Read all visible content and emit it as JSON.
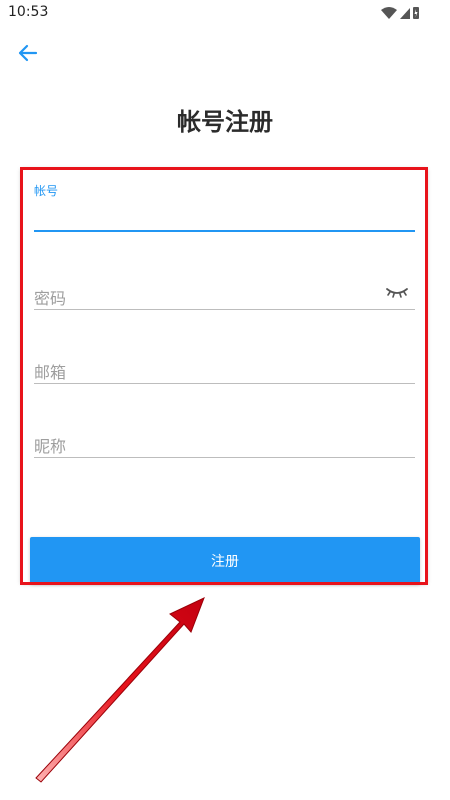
{
  "status_bar": {
    "time": "10:53",
    "icons": [
      "wifi-icon",
      "signal-icon",
      "battery-icon"
    ]
  },
  "header": {
    "back_icon": "back-arrow-icon",
    "title": "帐号注册"
  },
  "form": {
    "account": {
      "label": "帐号",
      "value": ""
    },
    "password": {
      "placeholder": "密码",
      "value": "",
      "toggle_icon": "eye-closed-icon"
    },
    "email": {
      "placeholder": "邮箱",
      "value": ""
    },
    "nickname": {
      "placeholder": "昵称",
      "value": ""
    },
    "submit_label": "注册"
  },
  "colors": {
    "accent": "#2196f3",
    "annotation": "#e8131b",
    "title": "#2b2b2b",
    "underline": "#bdbdbd"
  }
}
